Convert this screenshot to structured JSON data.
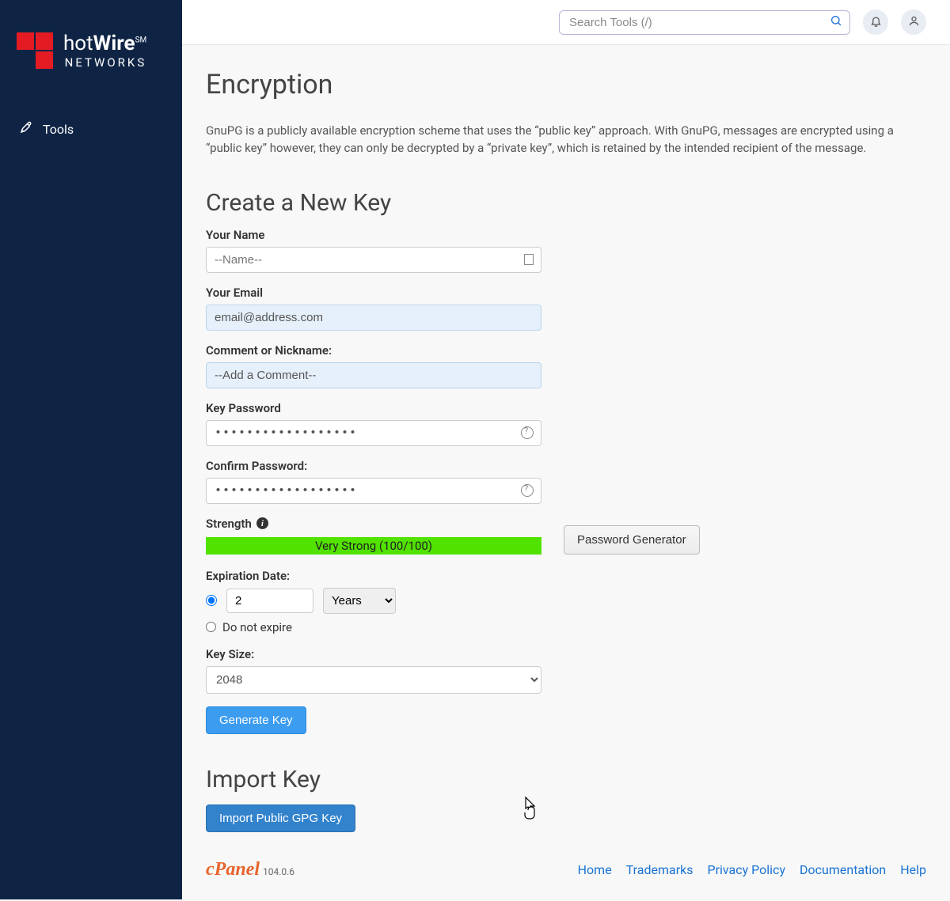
{
  "sidebar": {
    "brand_main_prefix": "hot",
    "brand_main_suffix": "Wire",
    "brand_sm": "SM",
    "brand_sub": "NETWORKS",
    "tools_label": "Tools"
  },
  "topbar": {
    "search_placeholder": "Search Tools (/)"
  },
  "page": {
    "title": "Encryption",
    "description": "GnuPG is a publicly available encryption scheme that uses the “public key” approach. With GnuPG, messages are encrypted using a “public key” however, they can only be decrypted by a “private key”, which is retained by the intended recipient of the message."
  },
  "form": {
    "section_title": "Create a New Key",
    "name_label": "Your Name",
    "name_placeholder": "--Name--",
    "email_label": "Your Email",
    "email_value": "email@address.com",
    "comment_label": "Comment or Nickname:",
    "comment_value": "--Add a Comment--",
    "password_label": "Key Password",
    "password_value": "••••••••••••••••••",
    "confirm_label": "Confirm Password:",
    "confirm_value": "••••••••••••••••••",
    "strength_label": "Strength",
    "strength_text": "Very Strong (100/100)",
    "pw_gen_btn": "Password Generator",
    "expiration_label": "Expiration Date:",
    "expiration_value": "2",
    "expiration_unit": "Years",
    "no_expire_label": "Do not expire",
    "keysize_label": "Key Size:",
    "keysize_value": "2048",
    "generate_btn": "Generate Key"
  },
  "import": {
    "section_title": "Import Key",
    "import_btn": "Import Public GPG Key"
  },
  "footer": {
    "brand": "cPanel",
    "version": "104.0.6",
    "links": [
      "Home",
      "Trademarks",
      "Privacy Policy",
      "Documentation",
      "Help"
    ]
  }
}
